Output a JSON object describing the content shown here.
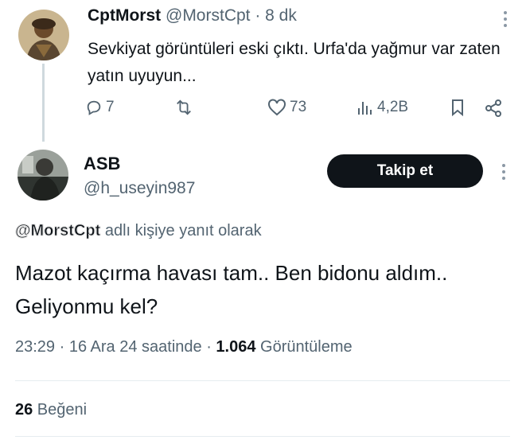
{
  "tweet1": {
    "display_name": "CptMorst",
    "handle": "@MorstCpt",
    "time": "· 8 dk",
    "text": "Sevkiyat görüntüleri eski çıktı. Urfa'da yağmur var zaten yatın uyuyun...",
    "replies": "7",
    "retweets": "",
    "likes": "73",
    "views": "4,2B"
  },
  "tweet2": {
    "display_name": "ASB",
    "handle": "@h_useyin987",
    "follow_label": "Takip et",
    "reply_mention": "@MorstCpt",
    "reply_suffix": " adlı kişiye yanıt olarak",
    "text": "Mazot kaçırma havası tam.. Ben bidonu aldım.. Geliyonmu kel?",
    "time": "23:29",
    "date_text": " · 16 Ara 24 saatinde · ",
    "view_count": "1.064",
    "view_label": " Görüntüleme",
    "like_count": "26",
    "like_label": " Beğeni"
  },
  "colors": {
    "text": "#0f1419",
    "secondary": "#536471",
    "follow_bg": "#0f1419",
    "divider": "#e6ecf0"
  },
  "icons": [
    "reply-icon",
    "retweet-icon",
    "like-icon",
    "views-icon",
    "bookmark-icon",
    "share-icon",
    "more-icon"
  ]
}
